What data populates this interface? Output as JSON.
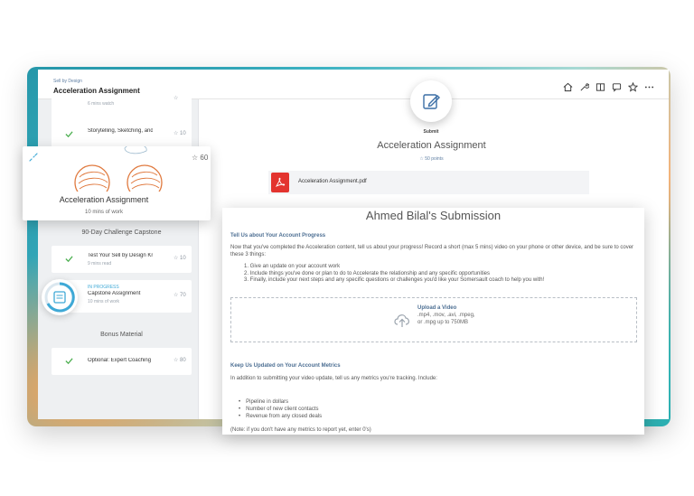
{
  "app": {
    "brand": "Sell by Design",
    "title": "Acceleration Assignment"
  },
  "sidebar": {
    "items": [
      {
        "title": "",
        "subtitle": "6 mins watch",
        "points": ""
      },
      {
        "title": "Storytelling, Sketching, and",
        "subtitle": "",
        "points": "10"
      }
    ],
    "section_capstone": "90-Day Challenge Capstone",
    "capstone_items": [
      {
        "title": "Test Your Sell by Design Knowledge",
        "subtitle": "9 mins read",
        "points": "10"
      },
      {
        "status": "IN PROGRESS",
        "title": "Capstone Assignment",
        "subtitle": "10 mins of work",
        "points": "70"
      }
    ],
    "section_bonus": "Bonus Material",
    "bonus_items": [
      {
        "title": "Optional: Expert Coaching",
        "points": "80"
      }
    ]
  },
  "float_card": {
    "title": "Acceleration Assignment",
    "subtitle": "10 mins of work",
    "points": "60"
  },
  "main": {
    "submit_label": "Submit",
    "title": "Acceleration Assignment",
    "points": "50 points",
    "file_name": "Acceleration Assignment.pdf"
  },
  "submission": {
    "title": "Ahmed Bilal's Submission",
    "heading1": "Tell Us about Your Account Progress",
    "intro": "Now that you've completed the Acceleration content, tell us about your progress! Record a short (max 5 mins) video on your phone or other device, and be sure to cover these 3 things:",
    "steps": [
      "1. Give an update on your account work",
      "2. Include things you've done or plan to do to Accelerate the relationship and any specific opportunities",
      "3. Finally, include your next steps and any specific questions or challenges you'd like your Somersault coach to help you with!"
    ],
    "upload_title": "Upload a Video",
    "upload_formats": ".mp4, .mov, .avi, .mpeg, or .mpg up to 750MB",
    "heading2": "Keep Us Updated on Your Account Metrics",
    "metrics_intro": "In addition to submitting your video update, tell us any metrics you're tracking. Include:",
    "metrics": [
      "Pipeline in dollars",
      "Number of new client contacts",
      "Revenue from any closed deals"
    ],
    "note": "(Note: if you don't have any metrics to report yet, enter 0's)"
  },
  "colors": {
    "accent": "#4d6f93",
    "check_green": "#4caf50",
    "pdf_red": "#e3342f",
    "progress_blue": "#3fa9d6"
  },
  "icons": [
    "home-icon",
    "wrench-icon",
    "notes-icon",
    "chat-icon",
    "star-icon",
    "more-icon",
    "check-icon",
    "pdf-icon",
    "upload-icon",
    "edit-icon",
    "document-icon"
  ]
}
